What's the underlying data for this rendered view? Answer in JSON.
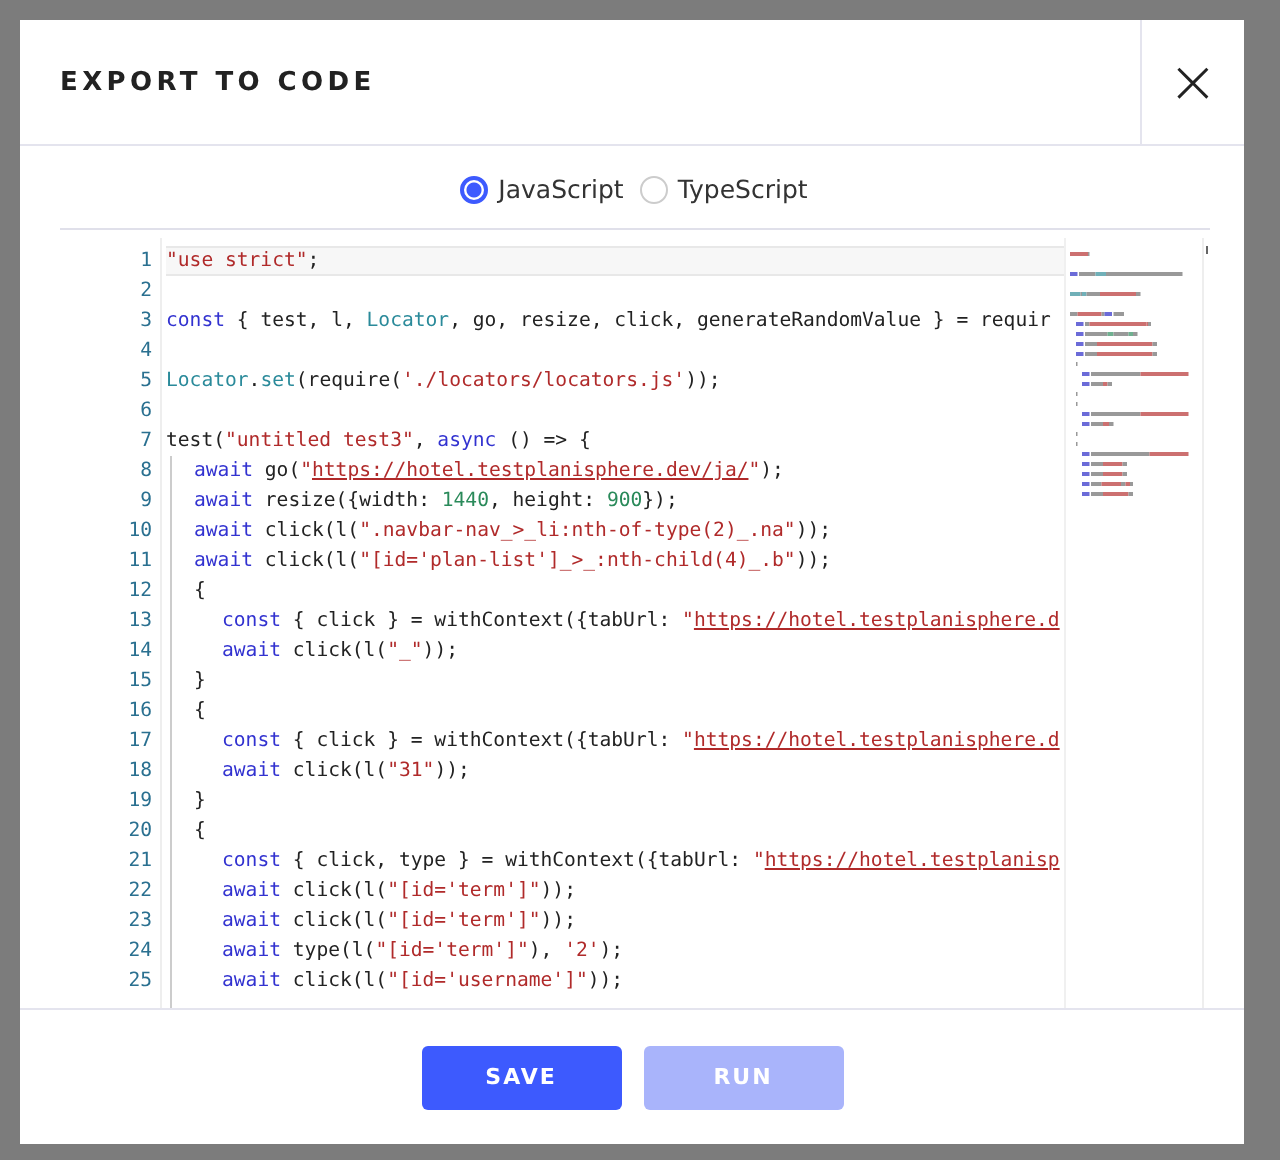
{
  "dialog": {
    "title": "EXPORT TO CODE",
    "close": "×"
  },
  "languages": [
    {
      "label": "JavaScript",
      "selected": true
    },
    {
      "label": "TypeScript",
      "selected": false
    }
  ],
  "editor": {
    "lines": [
      {
        "number": "1",
        "active": true,
        "tokens": [
          {
            "kind": "string",
            "text": "\"use strict\""
          },
          {
            "kind": "plain",
            "text": ";"
          }
        ]
      },
      {
        "number": "2",
        "active": false
      },
      {
        "number": "3",
        "active": false,
        "tokens": [
          {
            "kind": "keyword",
            "text": "const"
          },
          {
            "kind": "plain",
            "text": " { test, l, "
          },
          {
            "kind": "type",
            "text": "Locator"
          },
          {
            "kind": "plain",
            "text": ", go, resize, click, generateRandomValue } = requir"
          }
        ]
      },
      {
        "number": "4",
        "active": false
      },
      {
        "number": "5",
        "active": false,
        "tokens": [
          {
            "kind": "type",
            "text": "Locator"
          },
          {
            "kind": "plain",
            "text": "."
          },
          {
            "kind": "type",
            "text": "set"
          },
          {
            "kind": "plain",
            "text": "(require("
          },
          {
            "kind": "string",
            "text": "'./locators/locators.js'"
          },
          {
            "kind": "plain",
            "text": "));"
          }
        ]
      },
      {
        "number": "6",
        "active": false
      },
      {
        "number": "7",
        "active": false,
        "tokens": [
          {
            "kind": "plain",
            "text": "test("
          },
          {
            "kind": "string",
            "text": "\"untitled test3\""
          },
          {
            "kind": "plain",
            "text": ", "
          },
          {
            "kind": "keyword",
            "text": "async"
          },
          {
            "kind": "plain",
            "text": " () => {"
          }
        ],
        "children": [
          {
            "number": "8",
            "active": false,
            "tokens": [
              {
                "kind": "keyword",
                "text": "await"
              },
              {
                "kind": "plain",
                "text": " go("
              },
              {
                "kind": "string",
                "text": "\""
              },
              {
                "kind": "link",
                "text": "https://hotel.testplanisphere.dev/ja/"
              },
              {
                "kind": "string",
                "text": "\""
              },
              {
                "kind": "plain",
                "text": ");"
              }
            ]
          },
          {
            "number": "9",
            "active": false,
            "tokens": [
              {
                "kind": "keyword",
                "text": "await"
              },
              {
                "kind": "plain",
                "text": " resize({width: "
              },
              {
                "kind": "number",
                "text": "1440"
              },
              {
                "kind": "plain",
                "text": ", height: "
              },
              {
                "kind": "number",
                "text": "900"
              },
              {
                "kind": "plain",
                "text": "});"
              }
            ]
          },
          {
            "number": "10",
            "active": false,
            "tokens": [
              {
                "kind": "keyword",
                "text": "await"
              },
              {
                "kind": "plain",
                "text": " click(l("
              },
              {
                "kind": "string",
                "text": "\".navbar-nav_>_li:nth-of-type(2)_.na\""
              },
              {
                "kind": "plain",
                "text": "));"
              }
            ]
          },
          {
            "number": "11",
            "active": false,
            "tokens": [
              {
                "kind": "keyword",
                "text": "await"
              },
              {
                "kind": "plain",
                "text": " click(l("
              },
              {
                "kind": "string",
                "text": "\"[id='plan-list']_>_:nth-child(4)_.b\""
              },
              {
                "kind": "plain",
                "text": "));"
              }
            ]
          },
          {
            "number": "12",
            "active": false,
            "tokens": [
              {
                "kind": "plain",
                "text": "{"
              }
            ],
            "children": [
              {
                "number": "13",
                "active": false,
                "tokens": [
                  {
                    "kind": "keyword",
                    "text": "const"
                  },
                  {
                    "kind": "plain",
                    "text": " { click } = withContext({tabUrl: "
                  },
                  {
                    "kind": "string",
                    "text": "\""
                  },
                  {
                    "kind": "link",
                    "text": "https://hotel.testplanisphere.d"
                  }
                ]
              },
              {
                "number": "14",
                "active": false,
                "tokens": [
                  {
                    "kind": "keyword",
                    "text": "await"
                  },
                  {
                    "kind": "plain",
                    "text": " click(l("
                  },
                  {
                    "kind": "string",
                    "text": "\"_\""
                  },
                  {
                    "kind": "plain",
                    "text": "));"
                  }
                ]
              }
            ]
          },
          {
            "number": "15",
            "active": false,
            "tokens": [
              {
                "kind": "plain",
                "text": "}"
              }
            ]
          },
          {
            "number": "16",
            "active": false,
            "tokens": [
              {
                "kind": "plain",
                "text": "{"
              }
            ],
            "children": [
              {
                "number": "17",
                "active": false,
                "tokens": [
                  {
                    "kind": "keyword",
                    "text": "const"
                  },
                  {
                    "kind": "plain",
                    "text": " { click } = withContext({tabUrl: "
                  },
                  {
                    "kind": "string",
                    "text": "\""
                  },
                  {
                    "kind": "link",
                    "text": "https://hotel.testplanisphere.d"
                  }
                ]
              },
              {
                "number": "18",
                "active": false,
                "tokens": [
                  {
                    "kind": "keyword",
                    "text": "await"
                  },
                  {
                    "kind": "plain",
                    "text": " click(l("
                  },
                  {
                    "kind": "string",
                    "text": "\"31\""
                  },
                  {
                    "kind": "plain",
                    "text": "));"
                  }
                ]
              }
            ]
          },
          {
            "number": "19",
            "active": false,
            "tokens": [
              {
                "kind": "plain",
                "text": "}"
              }
            ]
          },
          {
            "number": "20",
            "active": false,
            "tokens": [
              {
                "kind": "plain",
                "text": "{"
              }
            ],
            "children": [
              {
                "number": "21",
                "active": false,
                "tokens": [
                  {
                    "kind": "keyword",
                    "text": "const"
                  },
                  {
                    "kind": "plain",
                    "text": " { click, type } = withContext({tabUrl: "
                  },
                  {
                    "kind": "string",
                    "text": "\""
                  },
                  {
                    "kind": "link",
                    "text": "https://hotel.testplanisp"
                  }
                ]
              },
              {
                "number": "22",
                "active": false,
                "tokens": [
                  {
                    "kind": "keyword",
                    "text": "await"
                  },
                  {
                    "kind": "plain",
                    "text": " click(l("
                  },
                  {
                    "kind": "string",
                    "text": "\"[id='term']\""
                  },
                  {
                    "kind": "plain",
                    "text": "));"
                  }
                ]
              },
              {
                "number": "23",
                "active": false,
                "tokens": [
                  {
                    "kind": "keyword",
                    "text": "await"
                  },
                  {
                    "kind": "plain",
                    "text": " click(l("
                  },
                  {
                    "kind": "string",
                    "text": "\"[id='term']\""
                  },
                  {
                    "kind": "plain",
                    "text": "));"
                  }
                ]
              },
              {
                "number": "24",
                "active": false,
                "tokens": [
                  {
                    "kind": "keyword",
                    "text": "await"
                  },
                  {
                    "kind": "plain",
                    "text": " type(l("
                  },
                  {
                    "kind": "string",
                    "text": "\"[id='term']\""
                  },
                  {
                    "kind": "plain",
                    "text": "), "
                  },
                  {
                    "kind": "string",
                    "text": "'2'"
                  },
                  {
                    "kind": "plain",
                    "text": ");"
                  }
                ]
              },
              {
                "number": "25",
                "active": false,
                "tokens": [
                  {
                    "kind": "keyword",
                    "text": "await"
                  },
                  {
                    "kind": "plain",
                    "text": " click(l("
                  },
                  {
                    "kind": "string",
                    "text": "\"[id='username']\""
                  },
                  {
                    "kind": "plain",
                    "text": "));"
                  }
                ]
              }
            ]
          }
        ]
      }
    ]
  },
  "buttons": [
    {
      "label": "SAVE",
      "disabled": false
    },
    {
      "label": "RUN",
      "disabled": true
    }
  ]
}
